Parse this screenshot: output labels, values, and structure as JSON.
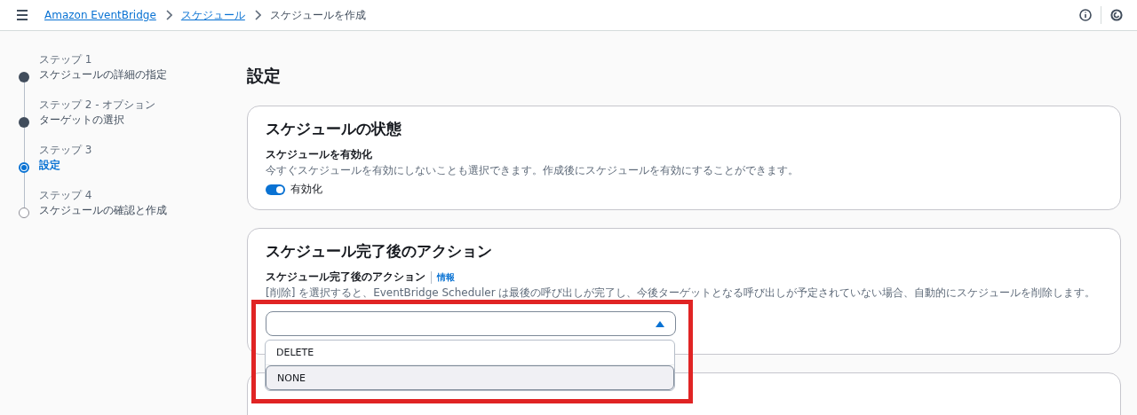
{
  "breadcrumbs": [
    {
      "label": "Amazon EventBridge",
      "link": true
    },
    {
      "label": "スケジュール",
      "link": true
    },
    {
      "label": "スケジュールを作成",
      "link": false
    }
  ],
  "steps": [
    {
      "step": "ステップ 1",
      "title": "スケジュールの詳細の指定",
      "done": true,
      "selected": false
    },
    {
      "step": "ステップ 2 - オプション",
      "title": "ターゲットの選択",
      "done": true,
      "selected": false
    },
    {
      "step": "ステップ 3",
      "title": "設定",
      "done": false,
      "selected": true
    },
    {
      "step": "ステップ 4",
      "title": "スケジュールの確認と作成",
      "done": false,
      "selected": false
    }
  ],
  "page_title": "設定",
  "state_card": {
    "title": "スケジュールの状態",
    "field_label": "スケジュールを有効化",
    "description": "今すぐスケジュールを有効にしないことも選択できます。作成後にスケジュールを有効にすることができます。",
    "toggle": {
      "label": "有効化",
      "on": true
    }
  },
  "action_card": {
    "title": "スケジュール完了後のアクション",
    "field_label": "スケジュール完了後のアクション",
    "info_link": "情報",
    "description": "[削除] を選択すると、EventBridge Scheduler は最後の呼び出しが完了し、今後ターゲットとなる呼び出しが予定されていない場合、自動的にスケジュールを削除します。",
    "dropdown": {
      "expanded": true,
      "options": [
        {
          "label": "DELETE",
          "highlighted": false
        },
        {
          "label": "NONE",
          "highlighted": true
        }
      ]
    }
  }
}
